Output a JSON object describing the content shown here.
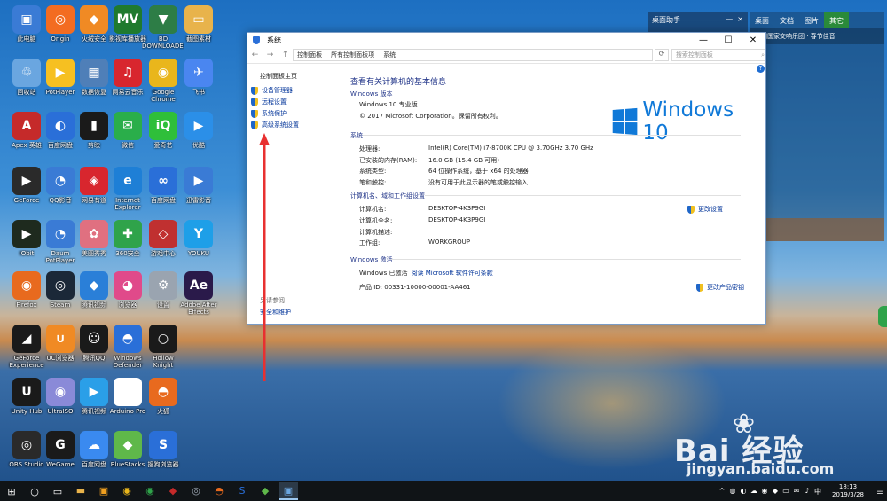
{
  "desktop_icons": [
    {
      "label": "此电脑",
      "c": "#3a7bd5",
      "g": "▣"
    },
    {
      "label": "Origin",
      "c": "#f36c21",
      "g": "◎"
    },
    {
      "label": "火绒安全",
      "c": "#f08a24",
      "g": "◆"
    },
    {
      "label": "影视库播放器",
      "c": "#1f7a2e",
      "g": "MV"
    },
    {
      "label": "BD DOWNLOADER",
      "c": "#2d7d46",
      "g": "▼"
    },
    {
      "label": "截图素材",
      "c": "#e8b34b",
      "g": "▭"
    },
    {
      "label": "回收站",
      "c": "#6aa6e0",
      "g": "♲"
    },
    {
      "label": "PotPlayer",
      "c": "#f6c021",
      "g": "▶"
    },
    {
      "label": "数据恢复",
      "c": "#4f7fb8",
      "g": "▦"
    },
    {
      "label": "网易云音乐",
      "c": "#d8262e",
      "g": "♫"
    },
    {
      "label": "Google Chrome",
      "c": "#e9b61c",
      "g": "◉"
    },
    {
      "label": "飞书",
      "c": "#4a86f0",
      "g": "✈"
    },
    {
      "label": "Apex 英雄",
      "c": "#c52a2a",
      "g": "A"
    },
    {
      "label": "百度网盘",
      "c": "#2a6fd8",
      "g": "◐"
    },
    {
      "label": "剪映",
      "c": "#1a1a1a",
      "g": "▮"
    },
    {
      "label": "微信",
      "c": "#2aae4a",
      "g": "✉"
    },
    {
      "label": "爱奇艺",
      "c": "#2fbf3a",
      "g": "iQ"
    },
    {
      "label": "优酷",
      "c": "#2b8fe8",
      "g": "▶"
    },
    {
      "label": "GeForce",
      "c": "#2a2a2a",
      "g": "▶"
    },
    {
      "label": "QQ影音",
      "c": "#3a7bd5",
      "g": "◔"
    },
    {
      "label": "网易有道",
      "c": "#d8262e",
      "g": "◈"
    },
    {
      "label": "Internet Explorer",
      "c": "#1e7fd6",
      "g": "e"
    },
    {
      "label": "百度网盘",
      "c": "#2a6fd8",
      "g": "∞"
    },
    {
      "label": "迅雷影音",
      "c": "#3a7bd5",
      "g": "▶"
    },
    {
      "label": "IObit",
      "c": "#1e2a1e",
      "g": "▶"
    },
    {
      "label": "Daum PotPlayer",
      "c": "#3a7bd5",
      "g": "◔"
    },
    {
      "label": "美图秀秀",
      "c": "#e07080",
      "g": "✿"
    },
    {
      "label": "360安全",
      "c": "#2fa34a",
      "g": "✚"
    },
    {
      "label": "游戏中心",
      "c": "#c03030",
      "g": "◇"
    },
    {
      "label": "YOUKU",
      "c": "#1e9fe8",
      "g": "Y"
    },
    {
      "label": "Firefox",
      "c": "#e86a1e",
      "g": "◉"
    },
    {
      "label": "Steam",
      "c": "#1b2838",
      "g": "◎"
    },
    {
      "label": "腾讯视频",
      "c": "#2a7fd8",
      "g": "◆"
    },
    {
      "label": "浏览器",
      "c": "#e04a8a",
      "g": "◕"
    },
    {
      "label": "设置",
      "c": "#9aa4b0",
      "g": "⚙"
    },
    {
      "label": "Adobe After Effects",
      "c": "#2a1a4a",
      "g": "Ae"
    },
    {
      "label": "GeForce Experience",
      "c": "#1a1a1a",
      "g": "◢"
    },
    {
      "label": "UC浏览器",
      "c": "#f08a24",
      "g": "∪"
    },
    {
      "label": "腾讯QQ",
      "c": "#1a1a1a",
      "g": "☺"
    },
    {
      "label": "Windows Defender",
      "c": "#2a6fd8",
      "g": "◓"
    },
    {
      "label": "Hollow Knight",
      "c": "#1a1a1a",
      "g": "○"
    },
    {
      "label": "",
      "c": "rgba(0,0,0,0)",
      "g": ""
    },
    {
      "label": "Unity Hub",
      "c": "#1a1a1a",
      "g": "U"
    },
    {
      "label": "UltraISO",
      "c": "#8a8ad8",
      "g": "◉"
    },
    {
      "label": "腾讯视频",
      "c": "#2a9fe8",
      "g": "▶"
    },
    {
      "label": "Arduino Pro",
      "c": "#ffffff",
      "g": "A"
    },
    {
      "label": "火狐",
      "c": "#e86a1e",
      "g": "◓"
    },
    {
      "label": "",
      "c": "rgba(0,0,0,0)",
      "g": ""
    },
    {
      "label": "OBS Studio",
      "c": "#2a2a2a",
      "g": "◎"
    },
    {
      "label": "WeGame",
      "c": "#1a1a1a",
      "g": "G"
    },
    {
      "label": "百度网盘",
      "c": "#3a8af0",
      "g": "☁"
    },
    {
      "label": "BlueStacks",
      "c": "#5fb84a",
      "g": "◆"
    },
    {
      "label": "搜狗浏览器",
      "c": "#2a6fd8",
      "g": "S"
    },
    {
      "label": "",
      "c": "rgba(0,0,0,0)",
      "g": ""
    }
  ],
  "right_panel_small": {
    "title": "桌面助手",
    "min": "—",
    "close": "×"
  },
  "right_panel": {
    "tabs": [
      "桌面",
      "文档",
      "图片",
      "其它"
    ],
    "news": "中国国家交响乐团 · 春节佳音"
  },
  "window": {
    "title": "系统",
    "controls": {
      "min": "—",
      "max": "☐",
      "close": "✕"
    },
    "nav": {
      "back": "←",
      "fwd": "→",
      "up": "↑"
    },
    "breadcrumb": [
      "控制面板",
      "所有控制面板项",
      "系统"
    ],
    "refresh": "⟳",
    "search_placeholder": "搜索控制面板",
    "left": {
      "home": "控制面板主页",
      "links": [
        "设备管理器",
        "远程设置",
        "系统保护",
        "高级系统设置"
      ],
      "see_also": "另请参阅",
      "security": "安全和维护"
    },
    "heading": "查看有关计算机的基本信息",
    "edition_h": "Windows 版本",
    "edition": "Windows 10 专业版",
    "copyright": "© 2017 Microsoft Corporation。保留所有权利。",
    "logo_text": "Windows 10",
    "system_h": "系统",
    "system_rows": [
      {
        "k": "处理器:",
        "v": "Intel(R) Core(TM) i7-8700K CPU @ 3.70GHz   3.70 GHz"
      },
      {
        "k": "已安装的内存(RAM):",
        "v": "16.0 GB (15.4 GB 可用)"
      },
      {
        "k": "系统类型:",
        "v": "64 位操作系统，基于 x64 的处理器"
      },
      {
        "k": "笔和触控:",
        "v": "没有可用于此显示器的笔或触控输入"
      }
    ],
    "computer_h": "计算机名、域和工作组设置",
    "computer_rows": [
      {
        "k": "计算机名:",
        "v": "DESKTOP-4K3P9GI"
      },
      {
        "k": "计算机全名:",
        "v": "DESKTOP-4K3P9GI"
      },
      {
        "k": "计算机描述:",
        "v": ""
      },
      {
        "k": "工作组:",
        "v": "WORKGROUP"
      }
    ],
    "change_settings": "更改设置",
    "activation_h": "Windows 激活",
    "activated": "Windows 已激活",
    "license_link": "阅读 Microsoft 软件许可条款",
    "product_id": "产品 ID: 00331-10000-00001-AA461",
    "change_key": "更改产品密钥",
    "help": "?"
  },
  "watermark": {
    "brand": "Bai  经验",
    "url": "jingyan.baidu.com",
    "paw": "❀"
  },
  "taskbar": {
    "start": "⊞",
    "search": "○",
    "taskview": "▭",
    "apps": [
      {
        "g": "▬",
        "c": "#e8b34b"
      },
      {
        "g": "▣",
        "c": "#f0a020"
      },
      {
        "g": "◉",
        "c": "#e9b61c"
      },
      {
        "g": "◉",
        "c": "#2fa34a"
      },
      {
        "g": "◆",
        "c": "#c52a2a"
      },
      {
        "g": "◎",
        "c": "#9aa4b0"
      },
      {
        "g": "◓",
        "c": "#e86a1e"
      },
      {
        "g": "S",
        "c": "#2a6fd8"
      },
      {
        "g": "◆",
        "c": "#5fb84a"
      },
      {
        "g": "▣",
        "c": "#6aa6e0"
      }
    ],
    "tray": [
      "^",
      "◍",
      "◐",
      "☁",
      "◉",
      "◆",
      "▭",
      "✉",
      "♪",
      "中"
    ],
    "time": "18:13",
    "date": "2019/3/28",
    "notify": "☰"
  },
  "colors": {
    "accent": "#1079d8",
    "link": "#003399",
    "heading": "#1e3287",
    "arrow": "#e83030"
  }
}
